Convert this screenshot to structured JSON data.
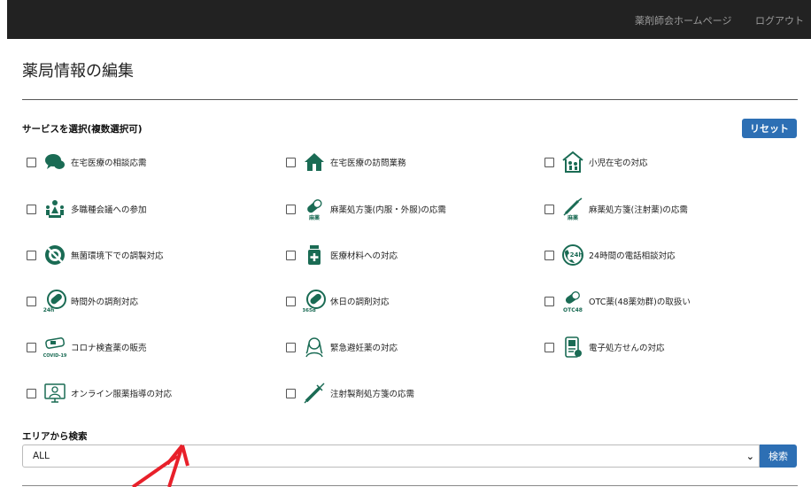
{
  "nav": {
    "home_link": "薬剤師会ホームページ",
    "logout_link": "ログアウト"
  },
  "page": {
    "title": "薬局情報の編集"
  },
  "services": {
    "section_label": "サービスを選択(複数選択可)",
    "reset_label": "リセット",
    "items": [
      {
        "label": "在宅医療の相談応需",
        "icon": "chat-bubble-icon"
      },
      {
        "label": "在宅医療の訪問業務",
        "icon": "house-icon"
      },
      {
        "label": "小児在宅の対応",
        "icon": "child-home-icon"
      },
      {
        "label": "多職種会議への参加",
        "icon": "meeting-icon"
      },
      {
        "label": "麻薬処方箋(内服・外服)の応需",
        "icon": "capsule-narcotic-icon",
        "icon_text": "麻薬"
      },
      {
        "label": "麻薬処方箋(注射薬)の応需",
        "icon": "syringe-narcotic-icon",
        "icon_text": "麻薬"
      },
      {
        "label": "無菌環境下での調製対応",
        "icon": "no-bacteria-icon"
      },
      {
        "label": "医療材料への対応",
        "icon": "medicine-bottle-icon"
      },
      {
        "label": "24時間の電話相談対応",
        "icon": "phone-24h-icon",
        "icon_text": "24h"
      },
      {
        "label": "時間外の調剤対応",
        "icon": "capsule-24h-icon",
        "icon_text": "24h"
      },
      {
        "label": "休日の調剤対応",
        "icon": "capsule-365d-icon",
        "icon_text": "365d"
      },
      {
        "label": "OTC薬(48薬効群)の取扱い",
        "icon": "otc48-icon",
        "icon_text": "OTC48"
      },
      {
        "label": "コロナ検査薬の販売",
        "icon": "covid-test-icon",
        "icon_text": "COVID-19"
      },
      {
        "label": "緊急避妊薬の対応",
        "icon": "woman-icon"
      },
      {
        "label": "電子処方せんの対応",
        "icon": "e-prescription-icon"
      },
      {
        "label": "オンライン服薬指導の対応",
        "icon": "online-consultation-icon"
      },
      {
        "label": "注射製剤処方箋の応需",
        "icon": "syringe-icon"
      }
    ]
  },
  "area": {
    "section_label": "エリアから検索",
    "selected": "ALL",
    "search_label": "検索"
  },
  "colors": {
    "icon": "#1a6b54",
    "accent": "#2d6fb4",
    "topbar": "#222222",
    "annotation_arrow": "#e8202a"
  }
}
